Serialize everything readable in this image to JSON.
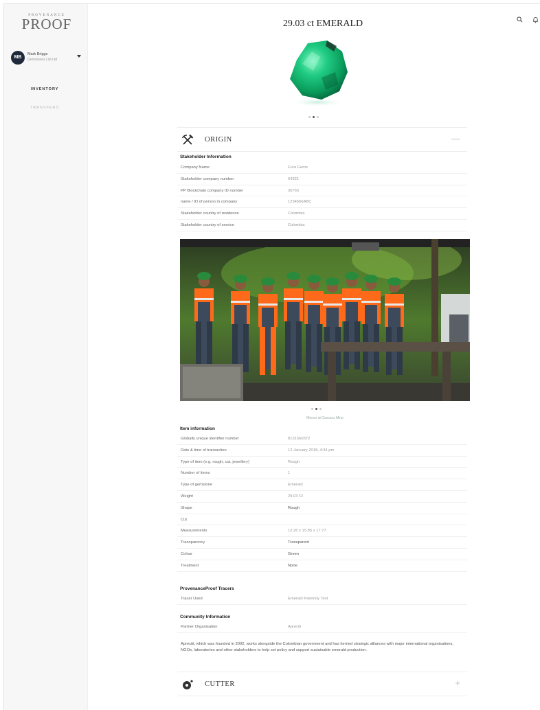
{
  "brand": {
    "top": "PROVENANCE",
    "main": "PROOF"
  },
  "user": {
    "initials": "MB",
    "name": "Mark Briggs",
    "role": "Gemstones List Ltd"
  },
  "nav": {
    "inventory": "INVENTORY",
    "transfers": "TRANSFERS"
  },
  "header_icons": {
    "search": "search-icon",
    "notifications": "bell-icon"
  },
  "title": "29.03 ct EMERALD",
  "gem_carousel": {
    "count": 3,
    "active": 1
  },
  "origin": {
    "title": "ORIGIN",
    "toggle": "—",
    "stakeholder_heading": "Stakeholder Information",
    "stakeholder_rows": [
      {
        "k": "Company Name",
        "v": "Fura Gems"
      },
      {
        "k": "Stakeholder company number",
        "v": "54321"
      },
      {
        "k": "PP Blockchain company ID number",
        "v": "36765"
      },
      {
        "k": "name / ID of person in company",
        "v": "1234566ABC"
      },
      {
        "k": "Stakeholder country of residence",
        "v": "Colombia"
      },
      {
        "k": "Stakeholder country of service",
        "v": "Colombia"
      }
    ],
    "photo_caption": "Miners at Coscuez Mine",
    "photo_carousel": {
      "count": 3,
      "active": 1
    },
    "item_heading": "Item information",
    "item_rows": [
      {
        "k": "Globally unique identifier number",
        "v": "8131560372"
      },
      {
        "k": "Date & time of transaction",
        "v": "12 January 2018, 4:34 pm"
      },
      {
        "k": "Type of item (e.g. rough, cut, jewellery)",
        "v": "Rough"
      },
      {
        "k": "Number of items",
        "v": "1"
      },
      {
        "k": "Type of gemstone",
        "v": "Emerald"
      },
      {
        "k": "Weight",
        "v": "29.03 Ct"
      },
      {
        "k": "Shape",
        "v": "Rough"
      },
      {
        "k": "Cut",
        "v": ""
      },
      {
        "k": "Measurements",
        "v": "12.26 x 15.85 x 17.77"
      },
      {
        "k": "Transparency",
        "v": "Transparent"
      },
      {
        "k": "Colour",
        "v": "Green"
      },
      {
        "k": "Treatment",
        "v": "None"
      }
    ],
    "tracers_heading": "ProvenanceProof Tracers",
    "tracers_rows": [
      {
        "k": "Tracer Used",
        "v": "Emerald Paternity Test"
      }
    ],
    "community_heading": "Community Information",
    "community_rows": [
      {
        "k": "Partner Organisation",
        "v": "Apreciti"
      }
    ],
    "community_text": "Apreciti, which was founded in 2002, works alongside the Colombian government and has formed strategic alliances with major international organisations, NGOs, laboratories and other stakeholders to help set policy and support sustainable emerald production."
  },
  "cutter": {
    "title": "CUTTER",
    "toggle": "+"
  },
  "colors": {
    "emerald": "#1bb873",
    "vest": "#ff6a1a",
    "helmet": "#2a8a3c"
  }
}
